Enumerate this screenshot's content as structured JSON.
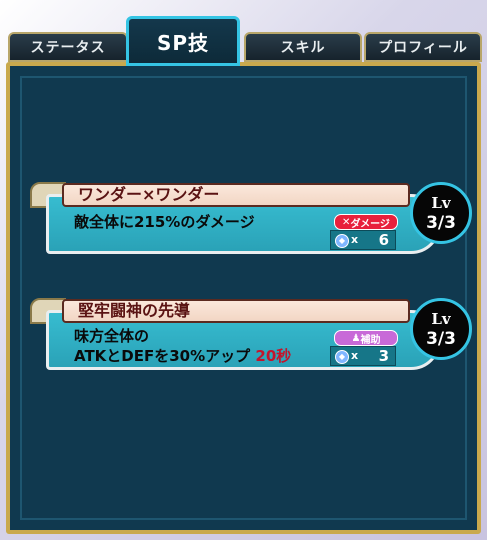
{
  "tabs": [
    {
      "label": "ステータス"
    },
    {
      "label": "SP技"
    },
    {
      "label": "スキル"
    },
    {
      "label": "プロフィール"
    }
  ],
  "skills": [
    {
      "name": "ワンダー×ワンダー",
      "desc_line1": "敵全体に215%のダメージ",
      "desc_line2": "",
      "duration": "",
      "category": "ダメージ",
      "cost_prefix": "x",
      "cost": "6",
      "lv_label": "Lv",
      "level": "3/3"
    },
    {
      "name": "堅牢闘神の先導",
      "desc_line1": "味方全体の",
      "desc_line2": "ATKとDEFを30%アップ",
      "duration": "20秒",
      "category": "補助",
      "cost_prefix": "x",
      "cost": "3",
      "lv_label": "Lv",
      "level": "3/3"
    }
  ],
  "colors": {
    "accent": "#35c4e4",
    "gold": "#c9a94d",
    "damage": "#e8203c",
    "support": "#c86ad8"
  }
}
